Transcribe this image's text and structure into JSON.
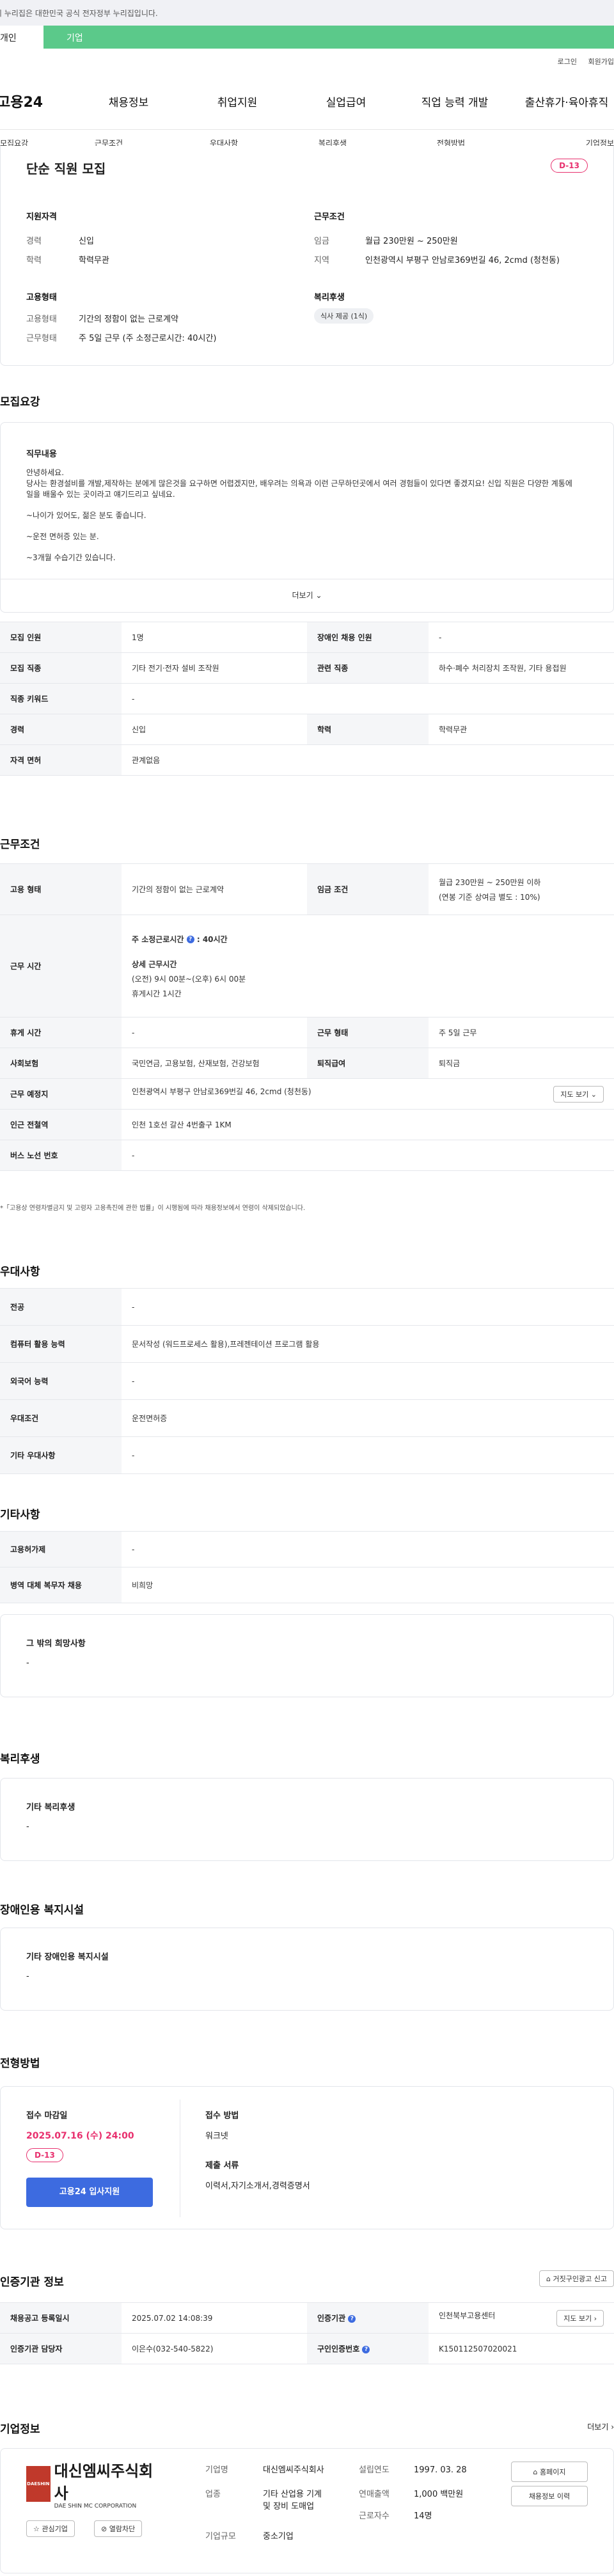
{
  "gov_banner": "이 누리집은 대한민국 공식 전자정부 누리집입니다.",
  "tabs": {
    "a": "개인",
    "b": "기업"
  },
  "util": {
    "login": "로그인",
    "join": "회원가입"
  },
  "nav": {
    "logo": "고용24",
    "items": [
      "채용정보",
      "취업지원",
      "실업급여",
      "직업 능력 개발",
      "출산휴가·육아휴직"
    ]
  },
  "subnav": [
    "모집요강",
    "근무조건",
    "우대사항",
    "복리후생",
    "전형방법",
    "기업정보"
  ],
  "job": {
    "title": "단순 직원 모집",
    "dday": "D-13",
    "qual_title": "지원자격",
    "career_k": "경력",
    "career_v": "신입",
    "edu_k": "학력",
    "edu_v": "학력무관",
    "emp_title": "고용형태",
    "emptype_k": "고용형태",
    "emptype_v": "기간의 정함이 없는 근로계약",
    "worktype_k": "근무형태",
    "worktype_v": "주 5일 근무 (주 소정근로시간: 40시간)",
    "cond_title": "근무조건",
    "wage_k": "임금",
    "wage_v": "월급 230만원 ~ 250만원",
    "region_k": "지역",
    "region_v": "인천광역시 부평구 안남로369번길 46, 2cmd (청천동)",
    "welfare_title": "복리후생",
    "welfare_pill": "식사 제공 (1식)"
  },
  "recruit": {
    "section": "모집요강",
    "duty_label": "직무내용",
    "lines": [
      "안녕하세요.",
      "당사는 환경설비를 개발,제작하는 분에게 많은것을 요구하면 어렵겠지만, 배우려는 의욕과 이런 근무하던곳에서 여러 경험들이 있다면 좋겠지요! 신입 직원은 다양한 계통에 일을 배울수 있는 곳이라고 얘기드리고 싶네요.",
      "~나이가 있어도, 젊은 분도 좋습니다.",
      "~운전 면허증 있는 분.",
      "~3개월 수습기간 있습니다."
    ],
    "more": "더보기",
    "table": [
      [
        "모집 인원",
        "1명",
        "장애인 채용 인원",
        "-"
      ],
      [
        "모집 직종",
        "기타 전기·전자 설비 조작원",
        "관련 직종",
        "하수·폐수 처리장치 조작원, 기타 용접원"
      ],
      [
        "직종 키워드",
        "-",
        "",
        ""
      ],
      [
        "경력",
        "신입",
        "학력",
        "학력무관"
      ],
      [
        "자격 면허",
        "관계없음",
        "",
        ""
      ]
    ]
  },
  "work": {
    "section": "근무조건",
    "emp_k": "고용 형태",
    "emp_v": "기간의 정함이 없는 근로계약",
    "wage_k": "임금 조건",
    "wage_v1": "월급 230만원 ~ 250만원 이하",
    "wage_v2": "(연봉 기준 상여금 별도 : 10%)",
    "time_k": "근무 시간",
    "time_main": "주 소정근로시간",
    "time_hours": ": 40시간",
    "time_detail_label": "상세 근무시간",
    "time_detail_1": "(오전) 9시 00분~(오후) 6시 00분",
    "time_detail_2": "휴게시간 1시간",
    "rest_k": "휴게 시간",
    "rest_v": "-",
    "form_k": "근무 형태",
    "form_v": "주 5일 근무",
    "ins_k": "사회보험",
    "ins_v": "국민연금, 고용보험, 산재보험, 건강보험",
    "ret_k": "퇴직급여",
    "ret_v": "퇴직금",
    "place_k": "근무 예정지",
    "place_v": "인천광역시 부평구 안남로369번길 46, 2cmd (청천동)",
    "map_btn": "지도 보기",
    "subway_k": "인근 전철역",
    "subway_v": "인천 1호선 갈산 4번출구 1KM",
    "bus_k": "버스 노선 번호",
    "bus_v": "-",
    "note": "*「고용상 연령차별금지 및 고령자 고용촉진에 관한 법률」이 시행됨에 따라 채용정보에서 연령이 삭제되었습니다."
  },
  "pref": {
    "section": "우대사항",
    "rows": [
      [
        "전공",
        "-"
      ],
      [
        "컴퓨터 활용 능력",
        "문서작성 (워드프로세스 활용),프레젠테이션 프로그램 활용"
      ],
      [
        "외국어 능력",
        "-"
      ],
      [
        "우대조건",
        "운전면허증"
      ],
      [
        "기타 우대사항",
        "-"
      ]
    ]
  },
  "etc": {
    "section": "기타사항",
    "rows": [
      [
        "고용허가제",
        "-"
      ],
      [
        "병역 대체 복무자 채용",
        "비희망"
      ]
    ],
    "box_label": "그 밖의 희망사항",
    "box_value": "-"
  },
  "welfare": {
    "section": "복리후생",
    "label": "기타 복리후생",
    "value": "-"
  },
  "disabled": {
    "section": "장애인용 복지시설",
    "label": "기타 장애인용 복지시설",
    "value": "-"
  },
  "process": {
    "section": "전형방법",
    "deadline_label": "접수 마감일",
    "deadline": "2025.07.16 (수) 24:00",
    "dday": "D-13",
    "apply_btn": "고용24 입사지원",
    "method_label": "접수 방법",
    "method": "워크넷",
    "docs_label": "제출 서류",
    "docs": "이력서,자기소개서,경력증명서"
  },
  "cert": {
    "section": "인증기관 정보",
    "report_btn": "거짓구인광고 신고",
    "reg_k": "채용공고 등록일시",
    "reg_v": "2025.07.02 14:08:39",
    "org_k": "인증기관",
    "org_v": "인천북부고용센터",
    "map_btn": "지도 보기",
    "mgr_k": "인증기관 담당자",
    "mgr_v": "이은수(032-540-5822)",
    "no_k": "구인인증번호",
    "no_v": "K150112507020021"
  },
  "company": {
    "section": "기업정보",
    "more": "더보기",
    "logo_ko": "대신엠씨주식회사",
    "logo_en": "DAE SHIN MC CORPORATION",
    "logo_mark": "DAESHIN",
    "fav_btn": "관심기업",
    "block_btn": "열람차단",
    "name_k": "기업명",
    "name_v": "대신엠씨주식회사",
    "ind_k": "업종",
    "ind_v1": "기타 산업용 기계",
    "ind_v2": "및 장비 도매업",
    "size_k": "기업규모",
    "size_v": "중소기업",
    "est_k": "설립연도",
    "est_v": "1997. 03. 28",
    "rev_k": "연매출액",
    "rev_v": "1,000 백만원",
    "emp_k": "근로자수",
    "emp_v": "14명",
    "home_btn": "홈페이지",
    "hist_btn": "채용정보 이력"
  }
}
